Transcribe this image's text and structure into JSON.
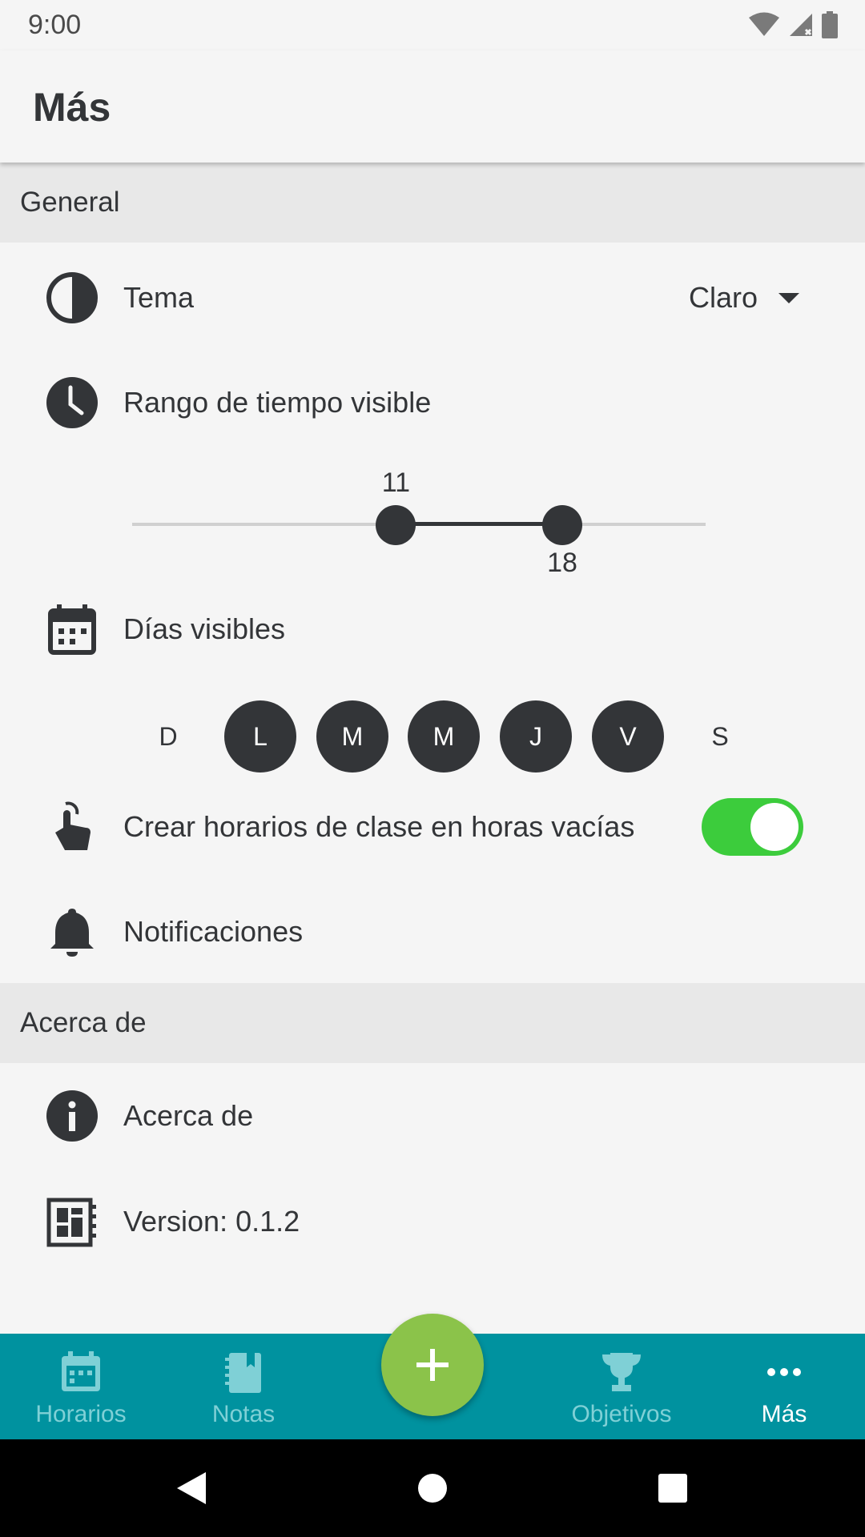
{
  "status_bar": {
    "time": "9:00"
  },
  "app_bar": {
    "title": "Más"
  },
  "sections": {
    "general": "General",
    "about": "Acerca de"
  },
  "settings": {
    "theme": {
      "label": "Tema",
      "value": "Claro",
      "icon": "theme-contrast-icon"
    },
    "time_range": {
      "label": "Rango de tiempo visible",
      "icon": "clock-icon",
      "min": 11,
      "max": 18,
      "min_label": "11",
      "max_label": "18",
      "range_min_fraction": 0.46,
      "range_max_fraction": 0.75
    },
    "visible_days": {
      "label": "Días visibles",
      "icon": "calendar-icon",
      "days": [
        {
          "letter": "D",
          "selected": false
        },
        {
          "letter": "L",
          "selected": true
        },
        {
          "letter": "M",
          "selected": true
        },
        {
          "letter": "M",
          "selected": true
        },
        {
          "letter": "J",
          "selected": true
        },
        {
          "letter": "V",
          "selected": true
        },
        {
          "letter": "S",
          "selected": false
        }
      ]
    },
    "empty_hours": {
      "label": "Crear horarios de clase en horas vacías",
      "enabled": true,
      "icon": "touch-icon"
    },
    "notifications": {
      "label": "Notificaciones",
      "icon": "bell-icon"
    },
    "about": {
      "label": "Acerca de",
      "icon": "info-icon"
    },
    "version": {
      "label": "Version: 0.1.2",
      "icon": "version-icon"
    }
  },
  "bottom_nav": {
    "items": [
      {
        "label": "Horarios",
        "icon": "calendar-icon",
        "active": false
      },
      {
        "label": "Notas",
        "icon": "notebook-icon",
        "active": false
      },
      {
        "label": "Objetivos",
        "icon": "trophy-icon",
        "active": false
      },
      {
        "label": "Más",
        "icon": "more-icon",
        "active": true
      }
    ],
    "fab_icon": "plus-icon"
  },
  "colors": {
    "accent_nav": "#00929f",
    "fab": "#8bc34a",
    "toggle_on": "#3ccc3c",
    "chip_on": "#333538"
  }
}
